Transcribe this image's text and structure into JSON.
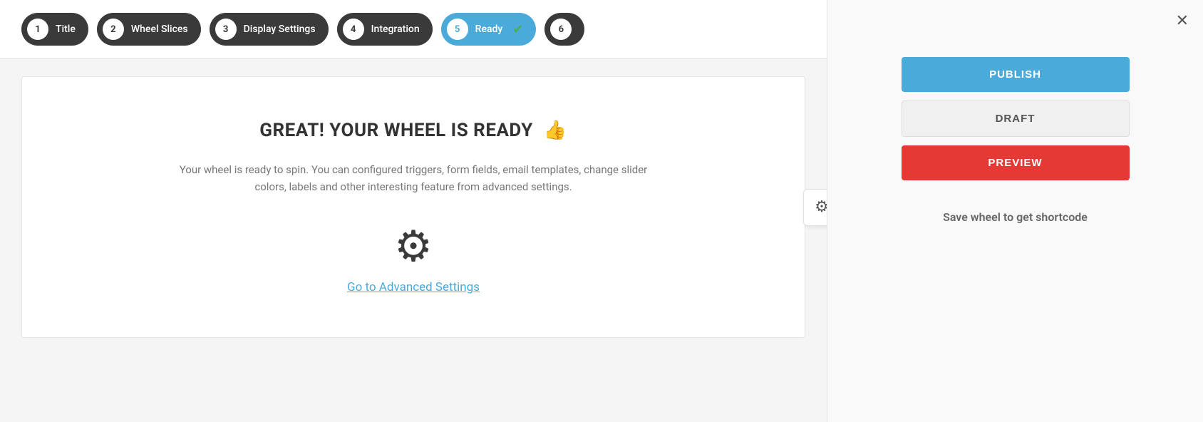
{
  "steps": [
    {
      "number": "1",
      "label": "Title",
      "active": false
    },
    {
      "number": "2",
      "label": "Wheel Slices",
      "active": false
    },
    {
      "number": "3",
      "label": "Display Settings",
      "active": false
    },
    {
      "number": "4",
      "label": "Integration",
      "active": false
    },
    {
      "number": "5",
      "label": "Ready",
      "active": true,
      "checked": true
    },
    {
      "number": "6",
      "label": "",
      "active": false
    }
  ],
  "content": {
    "title": "GREAT! YOUR WHEEL IS READY",
    "thumbs_up_emoji": "👍",
    "description": "Your wheel is ready to spin. You can configured triggers, form fields, email templates, change slider colors, labels and other interesting feature from advanced settings.",
    "advanced_settings_link": "Go to Advanced Settings"
  },
  "sidebar": {
    "publish_label": "PUBLISH",
    "draft_label": "DRAFT",
    "preview_label": "PREVIEW",
    "shortcode_text": "Save wheel to get shortcode"
  },
  "icons": {
    "close": "✕",
    "gear": "⚙",
    "check": "✓"
  },
  "colors": {
    "active_step": "#4aabdb",
    "publish_bg": "#4aabdb",
    "preview_bg": "#e53935",
    "check_green": "#4caf50"
  }
}
